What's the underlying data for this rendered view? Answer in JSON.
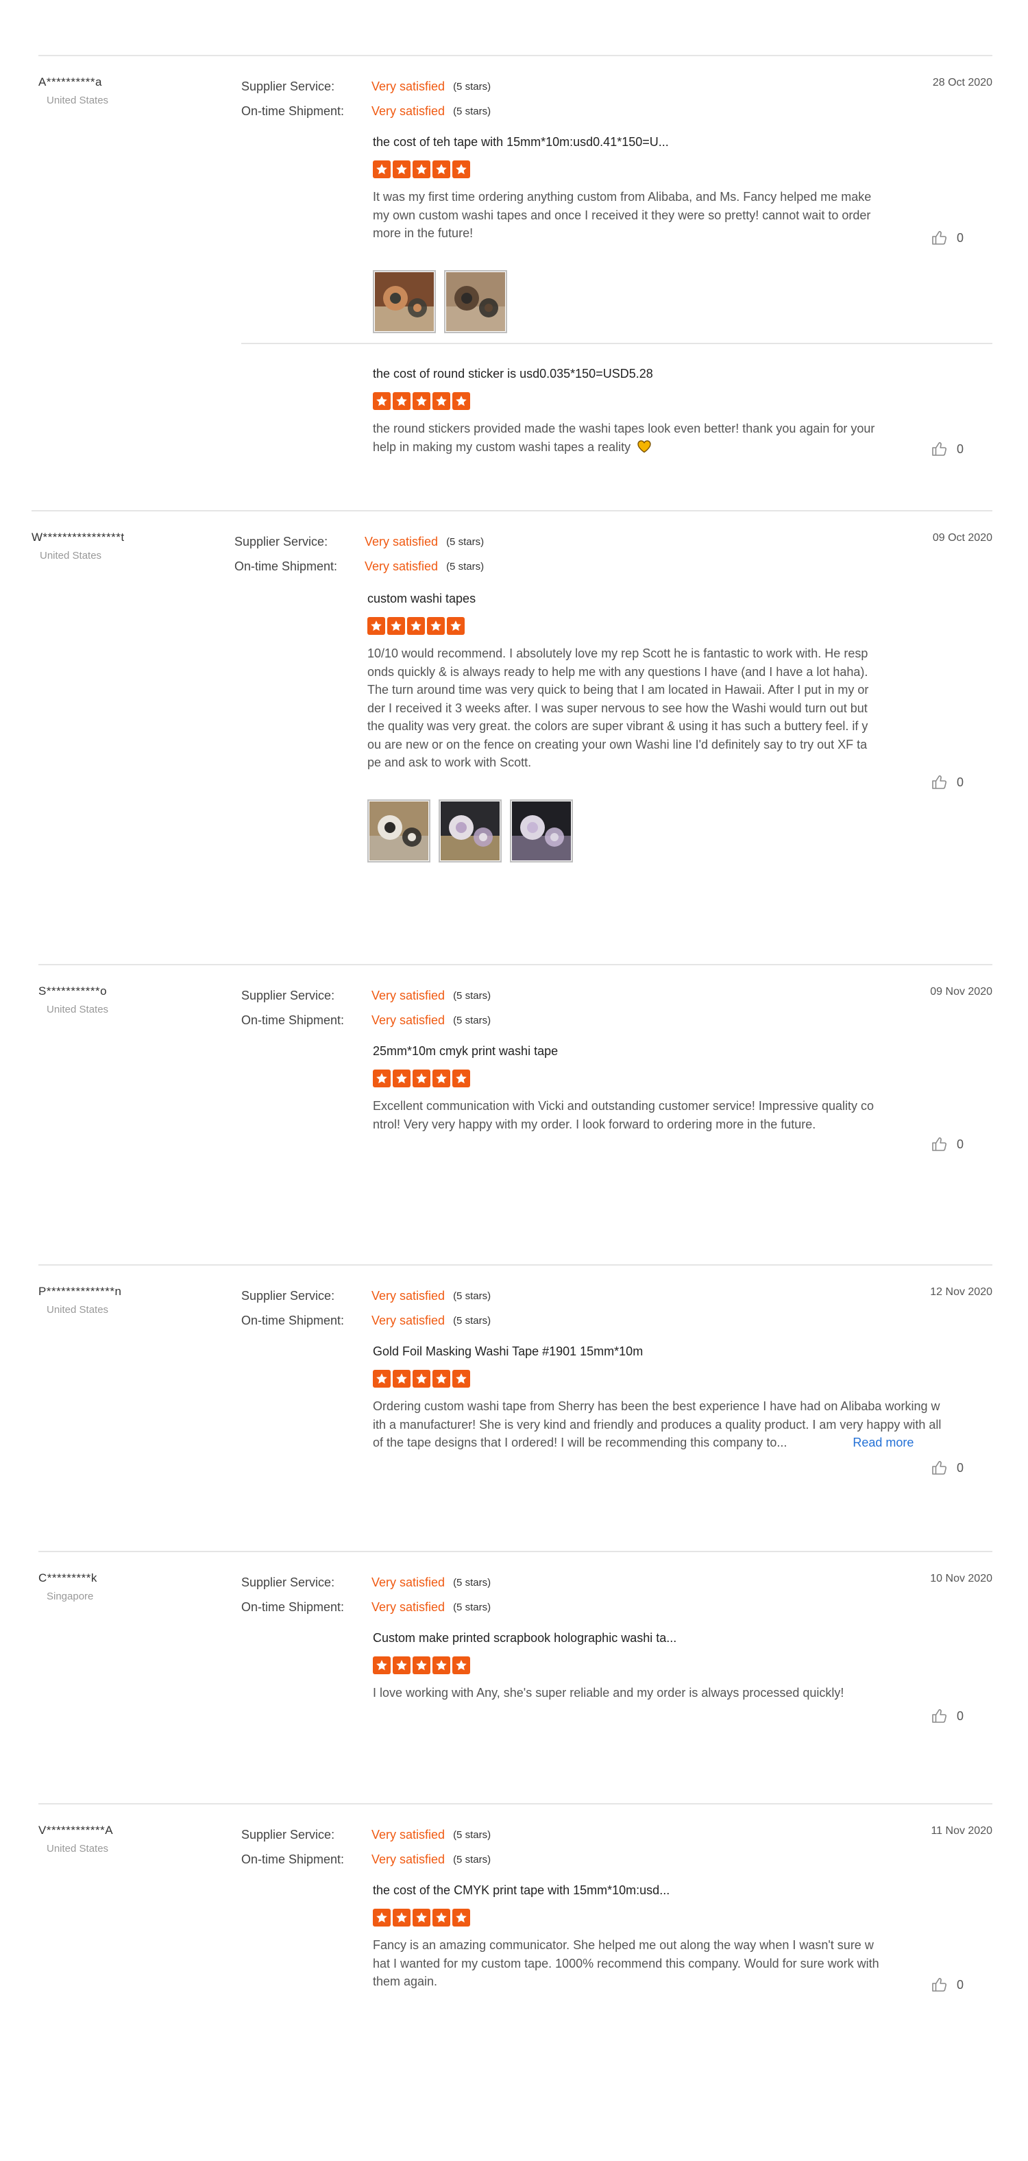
{
  "labels": {
    "supplier_service": "Supplier Service:",
    "on_time_shipment": "On-time Shipment:",
    "read_more": "Read more"
  },
  "colors": {
    "accent": "#f05a12",
    "link": "#2471d6",
    "divider": "#e5e5e5"
  },
  "icons": {
    "star": "star-icon",
    "like": "thumbs-up-icon",
    "heart": "heart-icon"
  },
  "reviews": [
    {
      "name": "A**********a",
      "country": "United States",
      "date": "28 Oct 2020",
      "supplier_service": {
        "value": "Very satisfied",
        "stars": "(5 stars)"
      },
      "on_time_shipment": {
        "value": "Very satisfied",
        "stars": "(5 stars)"
      },
      "feedbacks": [
        {
          "product": "the cost of teh tape with 15mm*10m:usd0.41*150=U...",
          "rating": 5,
          "comment": "It was my first time ordering anything custom from Alibaba, and Ms. Fancy helped me make my own custom washi tapes and once I received it they were so pretty! cannot wait to order more in the future!",
          "photos": 2,
          "likes": "0"
        },
        {
          "product": "the cost of round sticker is usd0.035*150=USD5.28",
          "rating": 5,
          "comment": "the round stickers provided made the washi tapes look even better! thank you again for your help in making my custom washi tapes a reality",
          "photos": 0,
          "likes": "0"
        }
      ]
    },
    {
      "name": "W****************t",
      "country": "United States",
      "date": "09 Oct 2020",
      "supplier_service": {
        "value": "Very satisfied",
        "stars": "(5 stars)"
      },
      "on_time_shipment": {
        "value": "Very satisfied",
        "stars": "(5 stars)"
      },
      "feedbacks": [
        {
          "product": "custom washi tapes",
          "rating": 5,
          "comment": "10/10 would recommend.  I absolutely love my rep Scott he is fantastic to work with. He responds quickly & is always ready to help me with any questions I have (and I have a lot haha).  The turn around time was very quick to being that I am located in Hawaii.  After I put in my order I received it 3 weeks after.  I was super nervous to see how the Washi would turn out but the quality was very great.  the colors are super vibrant & using it has such a buttery feel.  if you are new or on the fence on creating your own Washi line I'd definitely say to try out XF tape and ask to work with Scott.",
          "photos": 3,
          "likes": "0"
        }
      ]
    },
    {
      "name": "S***********o",
      "country": "United States",
      "date": "09 Nov 2020",
      "supplier_service": {
        "value": "Very satisfied",
        "stars": "(5 stars)"
      },
      "on_time_shipment": {
        "value": "Very satisfied",
        "stars": "(5 stars)"
      },
      "feedbacks": [
        {
          "product": "25mm*10m cmyk print washi tape",
          "rating": 5,
          "comment": "Excellent communication with Vicki and outstanding customer service! Impressive quality control! Very very happy with my order. I look forward to ordering more in the future.",
          "photos": 0,
          "likes": "0"
        }
      ]
    },
    {
      "name": "P**************n",
      "country": "United States",
      "date": "12 Nov 2020",
      "supplier_service": {
        "value": "Very satisfied",
        "stars": "(5 stars)"
      },
      "on_time_shipment": {
        "value": "Very satisfied",
        "stars": "(5 stars)"
      },
      "feedbacks": [
        {
          "product": "Gold Foil Masking Washi Tape #1901 15mm*10m",
          "rating": 5,
          "comment": "Ordering custom washi tape from Sherry has been the best experience I have had on Alibaba working with a manufacturer! She is very kind and friendly and produces a quality product. I am very happy with all of the tape designs that I ordered! I will be recommending this company to...",
          "photos": 0,
          "likes": "0"
        }
      ]
    },
    {
      "name": "C*********k",
      "country": "Singapore",
      "date": "10 Nov 2020",
      "supplier_service": {
        "value": "Very satisfied",
        "stars": "(5 stars)"
      },
      "on_time_shipment": {
        "value": "Very satisfied",
        "stars": "(5 stars)"
      },
      "feedbacks": [
        {
          "product": "Custom make printed scrapbook holographic washi ta...",
          "rating": 5,
          "comment": "I love working with Any, she's super reliable and my order is always processed quickly!",
          "photos": 0,
          "likes": "0"
        }
      ]
    },
    {
      "name": "V************A",
      "country": "United States",
      "date": "11 Nov 2020",
      "supplier_service": {
        "value": "Very satisfied",
        "stars": "(5 stars)"
      },
      "on_time_shipment": {
        "value": "Very satisfied",
        "stars": "(5 stars)"
      },
      "feedbacks": [
        {
          "product": "the cost of the CMYK print tape with 15mm*10m:usd...",
          "rating": 5,
          "comment": "Fancy is an amazing communicator. She helped me out along the way when I wasn't sure what I wanted for my custom tape. 1000% recommend this company. Would for sure work with them again.",
          "photos": 0,
          "likes": "0"
        }
      ]
    }
  ]
}
